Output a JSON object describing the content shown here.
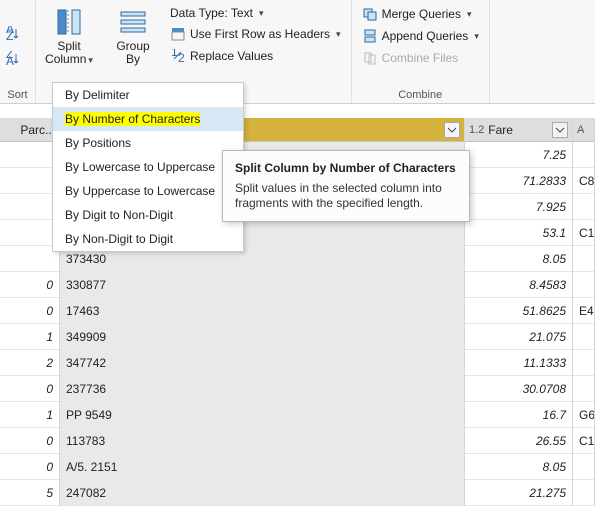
{
  "ribbon": {
    "sort_group_label": "Sort",
    "split_column_label": "Split\nColumn",
    "group_by_label": "Group\nBy",
    "data_type_label": "Data Type: Text",
    "first_row_headers_label": "Use First Row as Headers",
    "replace_values_label": "Replace Values",
    "merge_queries_label": "Merge Queries",
    "append_queries_label": "Append Queries",
    "combine_files_label": "Combine Files",
    "combine_group_label": "Combine"
  },
  "menu": {
    "items": [
      "By Delimiter",
      "By Number of Characters",
      "By Positions",
      "By Lowercase to Uppercase",
      "By Uppercase to Lowercase",
      "By Digit to Non-Digit",
      "By Non-Digit to Digit"
    ]
  },
  "tooltip": {
    "title": "Split Column by Number of Characters",
    "body": "Split values in the selected column into fragments with the specified length."
  },
  "grid": {
    "parc_header": "Parc...",
    "fare_type_prefix": "1.2",
    "fare_header": "Fare",
    "ext_header_prefix": "A",
    "rows": [
      {
        "parc": "",
        "ticket": "",
        "fare": "7.25",
        "ext": ""
      },
      {
        "parc": "",
        "ticket": "",
        "fare": "71.2833",
        "ext": "C8"
      },
      {
        "parc": "",
        "ticket": "",
        "fare": "7.925",
        "ext": ""
      },
      {
        "parc": "",
        "ticket": "",
        "fare": "53.1",
        "ext": "C1"
      },
      {
        "parc": "",
        "ticket": "373430",
        "fare": "8.05",
        "ext": ""
      },
      {
        "parc": "0",
        "ticket": "330877",
        "fare": "8.4583",
        "ext": ""
      },
      {
        "parc": "0",
        "ticket": "17463",
        "fare": "51.8625",
        "ext": "E4"
      },
      {
        "parc": "1",
        "ticket": "349909",
        "fare": "21.075",
        "ext": ""
      },
      {
        "parc": "2",
        "ticket": "347742",
        "fare": "11.1333",
        "ext": ""
      },
      {
        "parc": "0",
        "ticket": "237736",
        "fare": "30.0708",
        "ext": ""
      },
      {
        "parc": "1",
        "ticket": "PP 9549",
        "fare": "16.7",
        "ext": "G6"
      },
      {
        "parc": "0",
        "ticket": "113783",
        "fare": "26.55",
        "ext": "C1"
      },
      {
        "parc": "0",
        "ticket": "A/5. 2151",
        "fare": "8.05",
        "ext": ""
      },
      {
        "parc": "5",
        "ticket": "247082",
        "fare": "21.275",
        "ext": ""
      }
    ]
  }
}
